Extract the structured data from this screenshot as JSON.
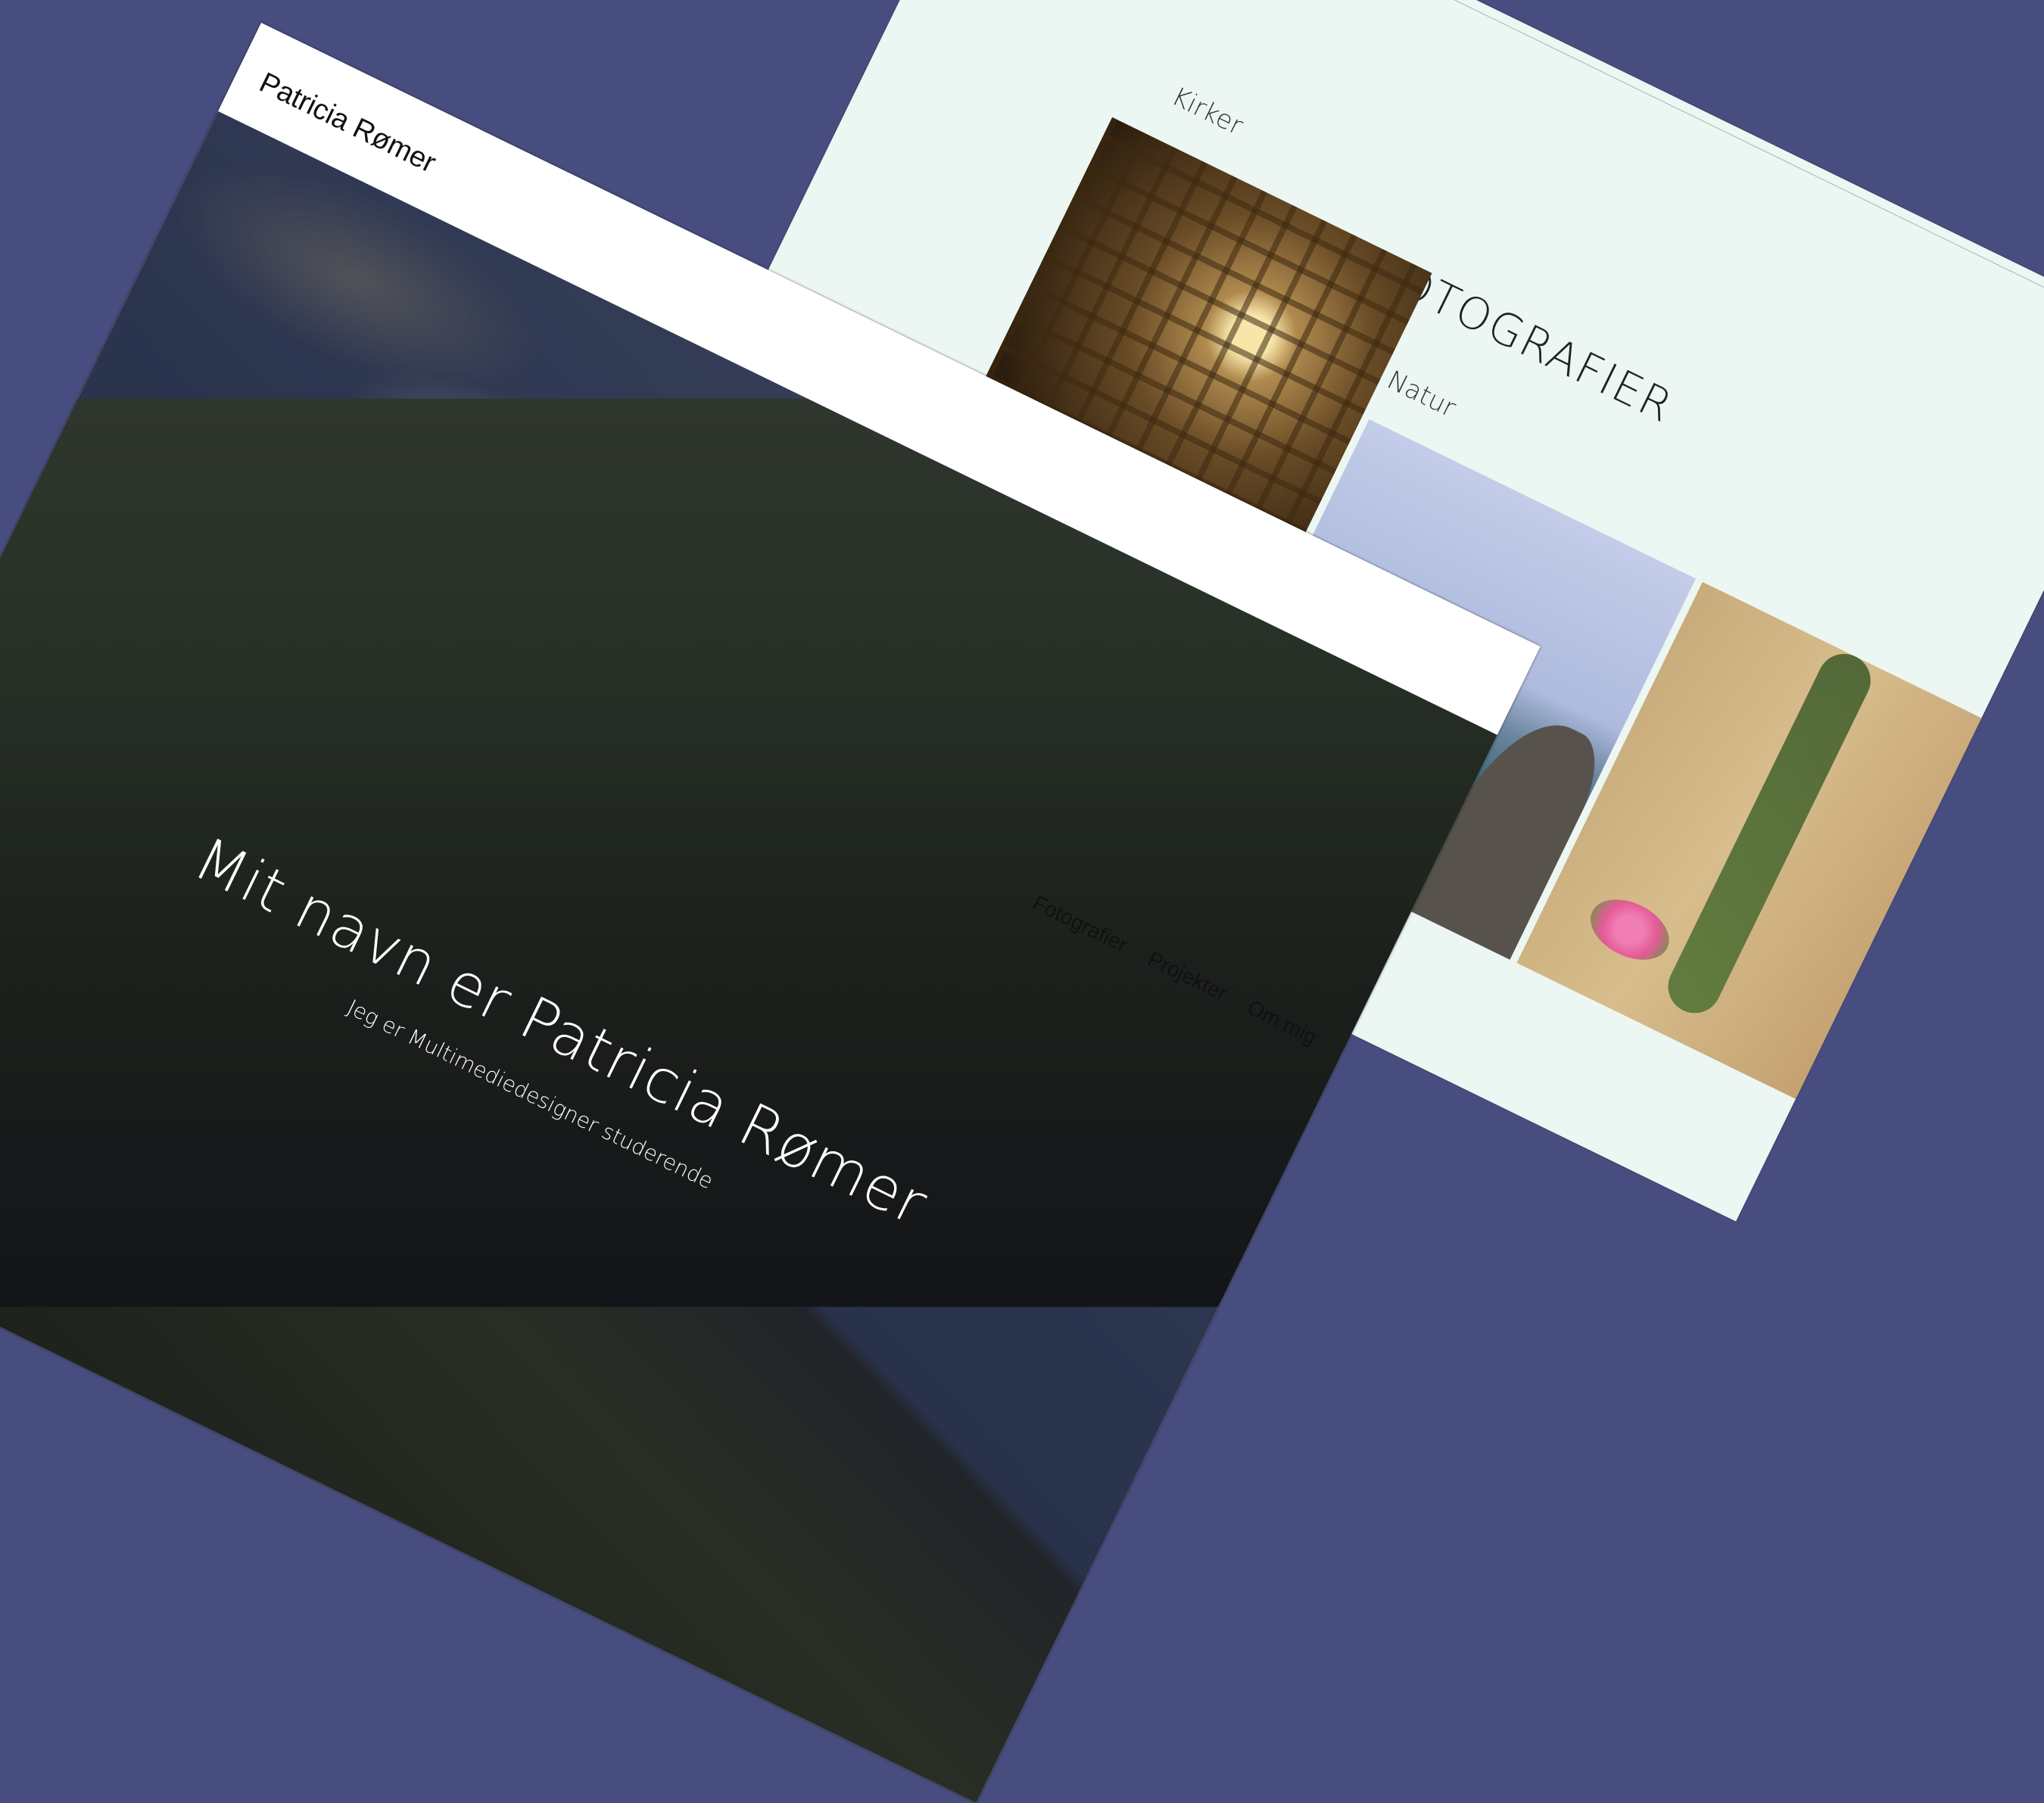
{
  "photography_page": {
    "title": "FOTOGRAFIER",
    "categories": [
      {
        "label": "Kirker"
      },
      {
        "label": "Natur"
      }
    ],
    "colors": {
      "background": "#ecf6f2"
    }
  },
  "portfolio_page": {
    "brand": "Patricia Rømer",
    "nav": {
      "items": [
        {
          "label": "Fotografier"
        },
        {
          "label": "Projekter"
        },
        {
          "label": "Om mig"
        }
      ]
    },
    "hero": {
      "title": "Mit navn er Patricia Rømer",
      "subtitle": "Jeg er Multimediedesigner studerende"
    }
  },
  "colors": {
    "background": "#474e7f",
    "card": "#ffffff"
  }
}
